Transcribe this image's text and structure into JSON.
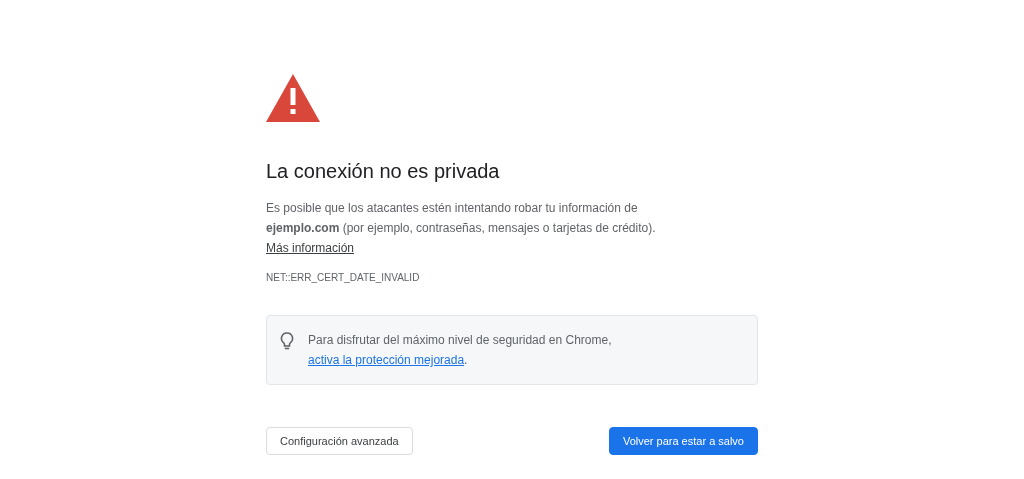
{
  "title": "La conexión no es privada",
  "message": {
    "text": "Es posible que los atacantes estén intentando robar tu información de **ejemplo.com** (por ejemplo, contraseñas, mensajes o tarjetas de crédito).",
    "link": "Más información"
  },
  "error_code": "NET::ERR_CERT_DATE_INVALID",
  "tip": {
    "text": "Para disfrutar del máximo nivel de seguridad en Chrome,",
    "link": "activa la protección mejorada",
    "after": "."
  },
  "buttons": [
    {
      "label": "Configuración avanzada",
      "kind": "secondary"
    },
    {
      "label": "Volver para estar a salvo",
      "kind": "primary"
    }
  ]
}
